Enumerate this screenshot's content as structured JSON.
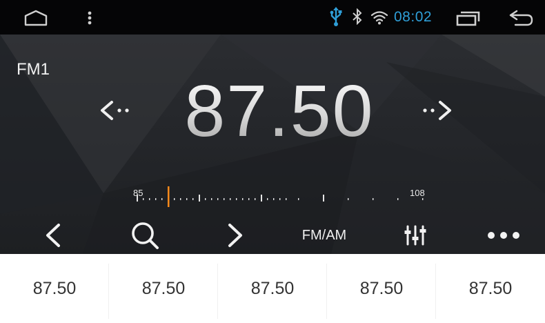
{
  "status_bar": {
    "time": "08:02",
    "time_color": "#2f9fd8",
    "usb_color": "#2f9fd8",
    "icons": [
      "home-icon",
      "menu-icon",
      "usb-icon",
      "bluetooth-icon",
      "wifi-icon",
      "recents-icon",
      "back-icon"
    ]
  },
  "radio": {
    "band": "FM1",
    "frequency": "87.50",
    "scale": {
      "min_label": "85",
      "max_label": "108",
      "min": 85,
      "max": 108,
      "needle_value": 87.5,
      "needle_color": "#ff8a1a"
    },
    "seek_prev_icon": "seek-prev-icon",
    "seek_next_icon": "seek-next-icon"
  },
  "toolbar": {
    "prev_icon": "chevron-left-icon",
    "search_icon": "search-icon",
    "next_icon": "chevron-right-icon",
    "band_toggle_label": "FM/AM",
    "eq_icon": "equalizer-icon",
    "more_icon": "more-icon"
  },
  "presets": [
    "87.50",
    "87.50",
    "87.50",
    "87.50",
    "87.50"
  ]
}
